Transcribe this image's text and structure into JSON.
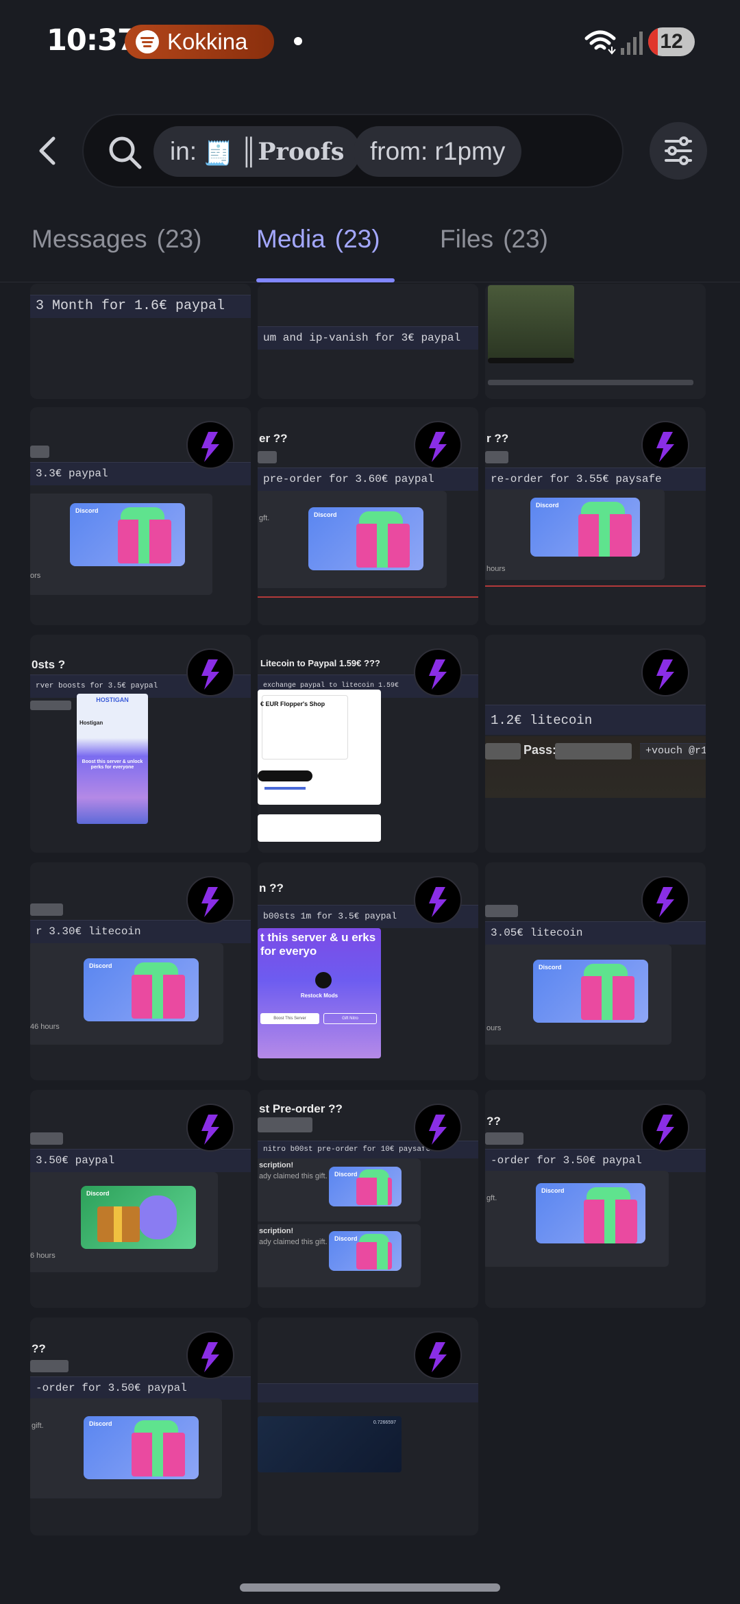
{
  "status_bar": {
    "time": "10:37",
    "now_playing": "Kokkina",
    "battery": "12"
  },
  "search": {
    "filter_in": "in:",
    "channel_name": "Proofs",
    "filter_from": "from: r1pmy"
  },
  "tabs": [
    {
      "label": "Messages",
      "count": "(23)"
    },
    {
      "label": "Media",
      "count": "(23)"
    },
    {
      "label": "Files",
      "count": "(23)"
    }
  ],
  "tiles": {
    "t1": {
      "caption": "3 Month for 1.6€ paypal"
    },
    "t2": {
      "caption": "um and ip-vanish for 3€ paypal"
    },
    "t4": {
      "caption": "3.3€ paypal",
      "note": "ors",
      "gift_label": "Discord"
    },
    "t5": {
      "title": "er ??",
      "caption": "pre-order for 3.60€ paypal",
      "note": "gft.",
      "gift_label": "Discord"
    },
    "t6": {
      "title": "r ??",
      "caption": "re-order for 3.55€ paysafe",
      "note": "hours",
      "gift_label": "Discord"
    },
    "t7": {
      "title": "0sts ?",
      "caption": "rver boosts for 3.5€ paypal",
      "host_label": "HOSTIGAN",
      "server_name": "Hostigan",
      "boost_text": "Boost this server & unlock perks for everyone"
    },
    "t8": {
      "title": "Litecoin to Paypal 1.59€ ???",
      "caption": "exchange paypal to litecoin 1.59€",
      "invoice_amount": "€ EUR",
      "shop_name": "Flopper's Shop"
    },
    "t9": {
      "caption": "1.2€ litecoin",
      "pass_label": "Pass:",
      "vouch": "+vouch @r1p"
    },
    "t10": {
      "caption": "r 3.30€ litecoin",
      "note": "46 hours",
      "gift_label": "Discord"
    },
    "t11": {
      "title": "n ??",
      "caption": "b00sts 1m for 3.5€ paypal",
      "boost_text": "t this server & u erks for everyo",
      "server_name": "Restock Mods",
      "button1": "Boost This Server",
      "button2": "Gift Nitro"
    },
    "t12": {
      "caption": "3.05€ litecoin",
      "note": "ours",
      "gift_label": "Discord"
    },
    "t13": {
      "caption": "3.50€ paypal",
      "note": "6 hours",
      "gift_label": "Discord"
    },
    "t14": {
      "title": "st Pre-order ??",
      "caption": "nitro b00st pre-order for 10€ paysafe",
      "line1": "scription!",
      "line2": "ady claimed this gift.",
      "gift_label": "Discord"
    },
    "t15": {
      "title": "??",
      "caption": "-order for 3.50€ paypal",
      "note": "gft.",
      "gift_label": "Discord"
    },
    "t16": {
      "title": "??",
      "caption": "-order for 3.50€ paypal",
      "note": "gift.",
      "gift_label": "Discord"
    },
    "t17": {
      "card_code": "0.7266597"
    }
  }
}
